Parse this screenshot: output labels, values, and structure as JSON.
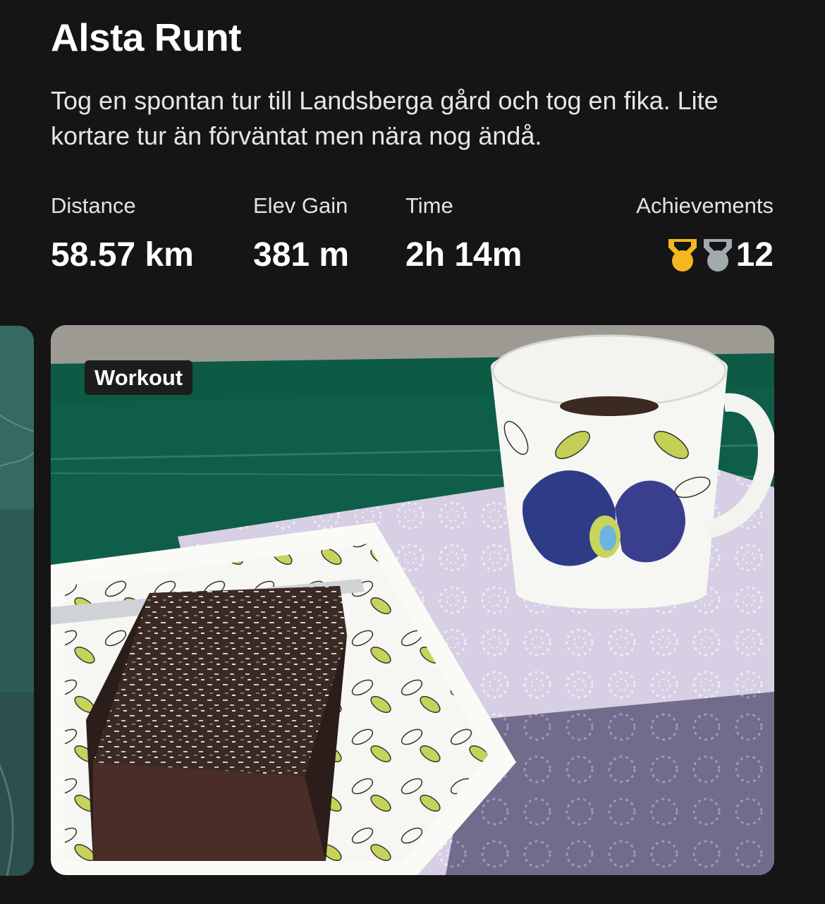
{
  "activity": {
    "title": "Alsta Runt",
    "description": "Tog en spontan tur till Landsberga gård och tog en fika. Lite kortare tur än förväntat men nära nog ändå."
  },
  "stats": {
    "distance": {
      "label": "Distance",
      "value": "58.57 km"
    },
    "elev_gain": {
      "label": "Elev Gain",
      "value": "381 m"
    },
    "time": {
      "label": "Time",
      "value": "2h 14m"
    },
    "achievements": {
      "label": "Achievements",
      "count": "12",
      "icons": [
        "gold-medal-icon",
        "silver-medal-icon"
      ]
    }
  },
  "media": {
    "badge": "Workout",
    "photo_subject": "chocolate coconut cake and coffee mug on patterned tray"
  },
  "colors": {
    "background": "#151515",
    "gold": "#F5B71F",
    "silver": "#A2AAAD",
    "badge_bg": "#1d1d1d"
  }
}
